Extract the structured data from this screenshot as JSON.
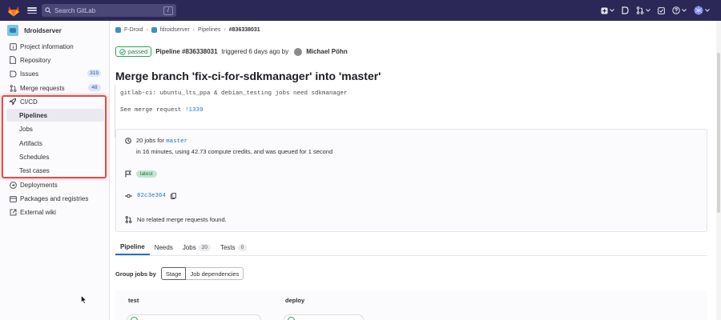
{
  "topbar": {
    "search_placeholder": "Search GitLab",
    "search_shortcut": "/"
  },
  "sidebar": {
    "project_name": "fdroidserver",
    "items": [
      {
        "label": "Project information",
        "icon": "info-icon"
      },
      {
        "label": "Repository",
        "icon": "file-icon"
      },
      {
        "label": "Issues",
        "icon": "issues-icon",
        "badge": "319"
      },
      {
        "label": "Merge requests",
        "icon": "merge-request-icon",
        "badge": "48"
      },
      {
        "label": "CI/CD",
        "icon": "rocket-icon"
      }
    ],
    "cicd_sub": [
      "Pipelines",
      "Jobs",
      "Artifacts",
      "Schedules",
      "Test cases"
    ],
    "after_items": [
      {
        "label": "Deployments",
        "icon": "deployments-icon"
      },
      {
        "label": "Packages and registries",
        "icon": "package-icon"
      },
      {
        "label": "External wiki",
        "icon": "external-link-icon"
      }
    ]
  },
  "breadcrumb": [
    "F-Droid",
    "fdroidserver",
    "Pipelines",
    "#836338031"
  ],
  "pipeline": {
    "status": "passed",
    "label": "Pipeline #836338031",
    "triggered": "triggered 6 days ago by",
    "user": "Michael Pöhn",
    "title": "Merge branch 'fix-ci-for-sdkmanager' into 'master'",
    "desc_line1": "gitlab-ci: ubuntu_lts_ppa & debian_testing jobs need sdkmanager",
    "desc_line2_prefix": "See merge request ",
    "desc_line2_link": "!1339"
  },
  "info": {
    "jobs_prefix": "20 jobs for ",
    "branch": "master",
    "duration": "in 16 minutes, using 42.73 compute credits, and was queued for 1 second",
    "tag": "latest",
    "commit": "82c3e364",
    "no_mr": "No related merge requests found."
  },
  "tabs": [
    {
      "label": "Pipeline",
      "count": ""
    },
    {
      "label": "Needs",
      "count": ""
    },
    {
      "label": "Jobs",
      "count": "20"
    },
    {
      "label": "Tests",
      "count": "0"
    }
  ],
  "group": {
    "label": "Group jobs by",
    "options": [
      "Stage",
      "Job dependencies"
    ]
  },
  "stages": [
    "test",
    "deploy"
  ],
  "colors": {
    "navbar": "#2b2857",
    "passed": "#2da160",
    "link": "#1f75cb",
    "highlight": "#d9534f"
  }
}
